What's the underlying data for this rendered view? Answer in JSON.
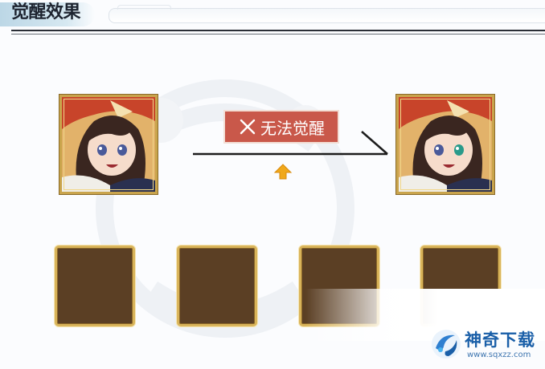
{
  "header": {
    "title": "觉醒效果"
  },
  "awakening": {
    "status_label": "无法觉醒",
    "status_icon": "crossed-swords-icon",
    "arrow_icon": "up-arrow-icon",
    "badge_color": "#c9584a"
  },
  "portraits": [
    {
      "name": "before",
      "character": "character-portrait"
    },
    {
      "name": "after",
      "character": "character-portrait"
    }
  ],
  "material_slots": [
    {
      "state": "empty"
    },
    {
      "state": "empty"
    },
    {
      "state": "empty"
    },
    {
      "state": "empty"
    }
  ],
  "watermark": {
    "name": "神奇下载",
    "url": "www.sqxzz.com"
  }
}
